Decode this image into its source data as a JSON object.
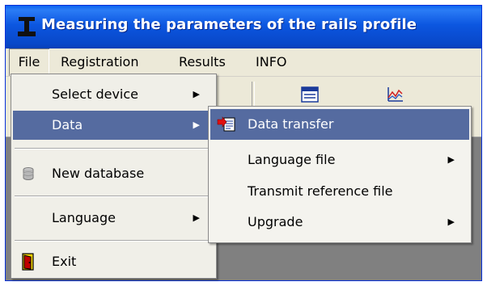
{
  "window": {
    "title": "Measuring the parameters of the rails profile"
  },
  "menubar": {
    "items": [
      {
        "label": "File"
      },
      {
        "label": "Registration"
      },
      {
        "label": "Results"
      },
      {
        "label": "INFO"
      }
    ]
  },
  "file_menu": {
    "items": [
      {
        "label": "Select device",
        "icon": "none",
        "has_submenu": true
      },
      {
        "label": "Data",
        "icon": "none",
        "has_submenu": true,
        "highlighted": true
      },
      {
        "label": "New database",
        "icon": "database-icon",
        "has_submenu": false
      },
      {
        "label": "Language",
        "icon": "none",
        "has_submenu": true
      },
      {
        "label": "Exit",
        "icon": "exit-door-icon",
        "has_submenu": false
      }
    ]
  },
  "data_submenu": {
    "items": [
      {
        "label": "Data transfer",
        "icon": "data-transfer-icon",
        "has_submenu": false,
        "highlighted": true
      },
      {
        "label": "Language file",
        "icon": "none",
        "has_submenu": true
      },
      {
        "label": "Transmit reference file",
        "icon": "none",
        "has_submenu": false
      },
      {
        "label": "Upgrade",
        "icon": "none",
        "has_submenu": true
      }
    ]
  },
  "colors": {
    "highlight": "#556ba0",
    "titlebar": "#0c56e0",
    "workarea": "#808080"
  }
}
